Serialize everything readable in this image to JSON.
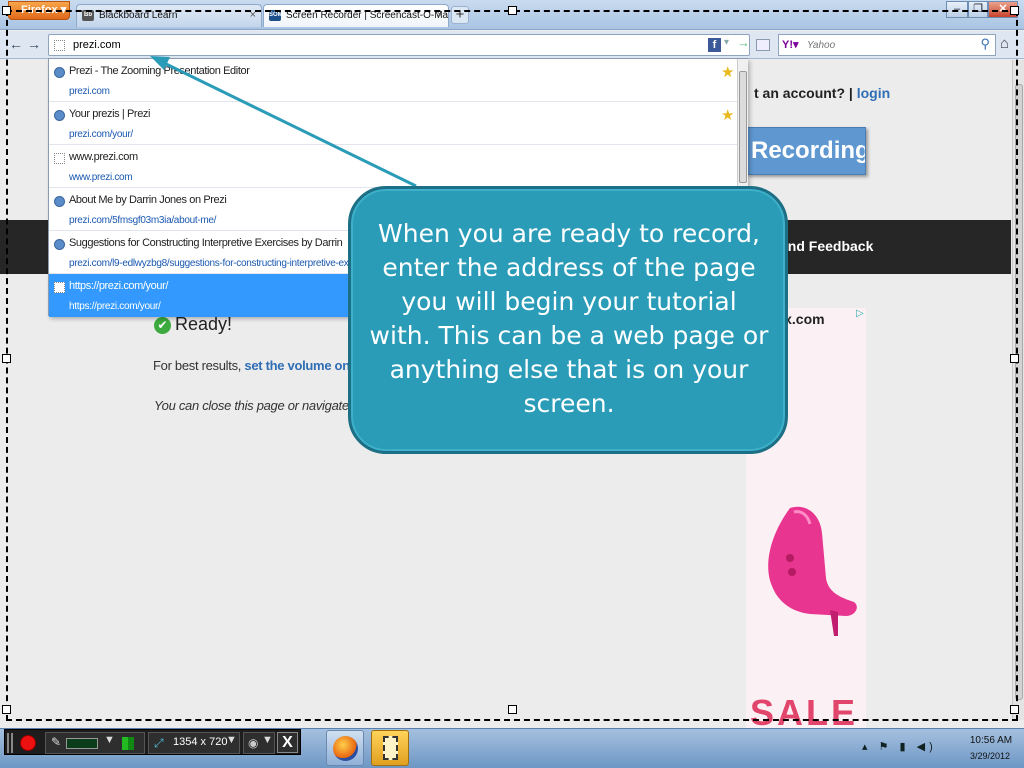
{
  "browser": {
    "menu_label": "Firefox ▾",
    "tabs": [
      {
        "label": "Blackboard Learn",
        "favicon": "Bb"
      },
      {
        "label": "Screen Recorder | Screencast-O-Mati...",
        "favicon": "SOM"
      }
    ],
    "new_tab": "+",
    "window_controls": {
      "minimize": "–",
      "maximize": "❐",
      "close": "✕"
    }
  },
  "nav": {
    "back": "←",
    "forward": "→",
    "url_value": "prezi.com",
    "fb": "f",
    "url_dropdown": "▾",
    "url_go": "→",
    "search_engine": "Y!▾",
    "search_placeholder": "Yahoo",
    "search_go": "⚲",
    "home": "⌂"
  },
  "suggestions": [
    {
      "title": "Prezi - The Zooming Presentation Editor",
      "url": "prezi.com",
      "starred": true,
      "icon": "globe-icon"
    },
    {
      "title": "Your prezis | Prezi",
      "url": "prezi.com/your/",
      "starred": true,
      "icon": "globe-icon"
    },
    {
      "title": "www.prezi.com",
      "url": "www.prezi.com",
      "starred": false,
      "icon": "blank-page-icon"
    },
    {
      "title": "About Me by Darrin Jones on Prezi",
      "url": "prezi.com/5fmsgf03m3ia/about-me/",
      "starred": false,
      "icon": "globe-icon"
    },
    {
      "title": "Suggestions for Constructing Interpretive Exercises by Darrin",
      "url": "prezi.com/l9-edlwyzbg8/suggestions-for-constructing-interpretive-ex",
      "starred": false,
      "icon": "globe-icon"
    },
    {
      "title": "https://prezi.com/your/",
      "url": "https://prezi.com/your/",
      "starred": false,
      "icon": "blank-page-icon",
      "selected": true
    }
  ],
  "page": {
    "account_prompt": "t an account?",
    "login": "login",
    "recording_button": "Recording",
    "feedback": "end Feedback",
    "ready": "Ready!",
    "best_results_prefix": "For best results,",
    "best_results_link": "set the volume on",
    "close_note": "You can close this page or navigate",
    "ad": {
      "brand": "thebox.com",
      "sale": "SALE"
    }
  },
  "callout": {
    "text": "When you are ready to record, enter the address of the page  you will begin your tutorial with.  This can be a web page or anything else that is on your screen."
  },
  "recorder": {
    "size": "1354 x 720",
    "close": "X"
  },
  "clock": {
    "time": "10:56 AM",
    "date": "3/29/2012"
  },
  "colors": {
    "callout": "#2a9cb8",
    "selected_suggestion": "#3399ff",
    "record": "#e11111"
  }
}
